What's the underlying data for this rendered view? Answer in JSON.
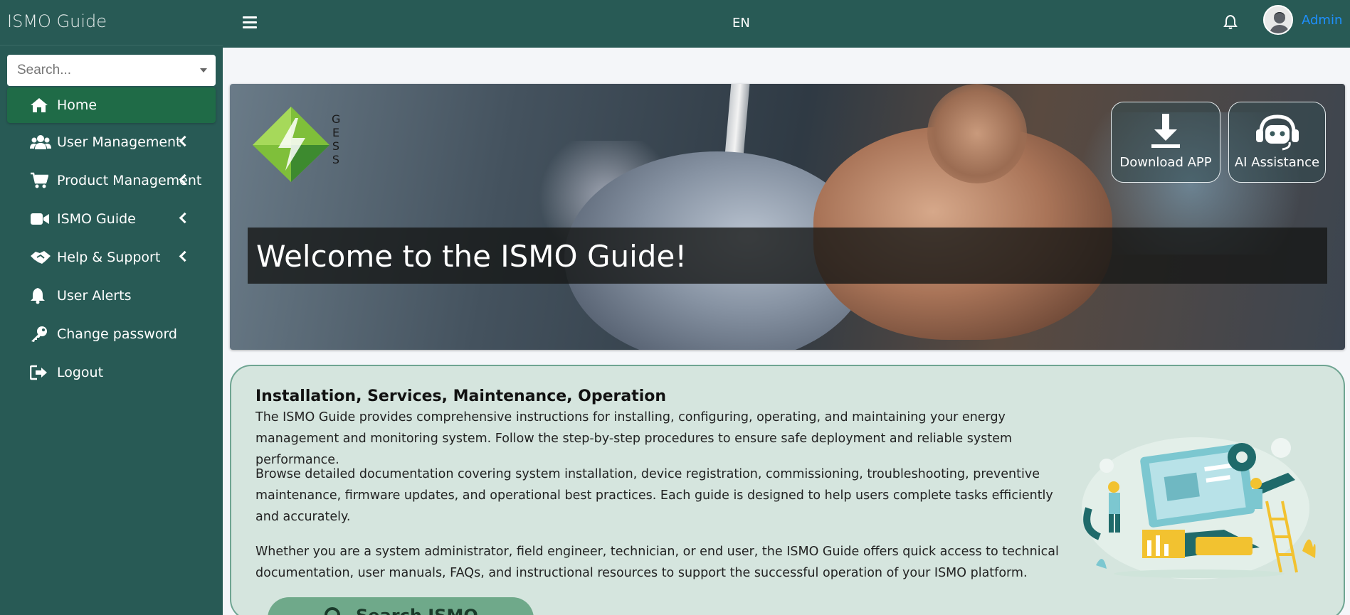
{
  "app": {
    "title": "ISMO Guide"
  },
  "sidebar": {
    "search_placeholder": "Search...",
    "items": [
      {
        "label": "Home",
        "icon": "home-icon",
        "active": true,
        "has_submenu": false
      },
      {
        "label": "User Management",
        "icon": "users-icon",
        "active": false,
        "has_submenu": true
      },
      {
        "label": "Product Management",
        "icon": "cart-icon",
        "active": false,
        "has_submenu": true
      },
      {
        "label": "ISMO Guide",
        "icon": "video-camera-icon",
        "active": false,
        "has_submenu": true
      },
      {
        "label": "Help & Support",
        "icon": "handshake-icon",
        "active": false,
        "has_submenu": true
      },
      {
        "label": "User Alerts",
        "icon": "bell-icon",
        "active": false,
        "has_submenu": false
      },
      {
        "label": "Change password",
        "icon": "key-icon",
        "active": false,
        "has_submenu": false
      },
      {
        "label": "Logout",
        "icon": "logout-icon",
        "active": false,
        "has_submenu": false
      }
    ]
  },
  "topbar": {
    "language": "EN",
    "user_name": "Admin"
  },
  "banner": {
    "logo_text": [
      "G",
      "E",
      "S",
      "S"
    ],
    "welcome": "Welcome to the ISMO Guide!",
    "download_label": "Download APP",
    "ai_label": "AI Assistance"
  },
  "info": {
    "heading": "Installation, Services, Maintenance, Operation",
    "paragraph1": "The ISMO Guide provides comprehensive instructions for installing, configuring, operating, and maintaining your energy management and monitoring system. Follow the step-by-step procedures to ensure safe deployment and reliable system performance.",
    "paragraph2": "Browse detailed documentation covering system installation, device registration, commissioning, troubleshooting, preventive maintenance, firmware updates, and operational best practices. Each guide is designed to help users complete tasks efficiently and accurately.",
    "paragraph3": "Whether you are a system administrator, field engineer, technician, or end user, the ISMO Guide offers quick access to technical documentation, user manuals, FAQs, and instructional resources to support the successful operation of your ISMO platform.",
    "cta_label": "Search ISMO"
  },
  "colors": {
    "sidebar_bg": "#285a55",
    "active_item": "#1f6b47",
    "card_bg": "#d5e5de",
    "accent_link": "#1e90ff"
  }
}
